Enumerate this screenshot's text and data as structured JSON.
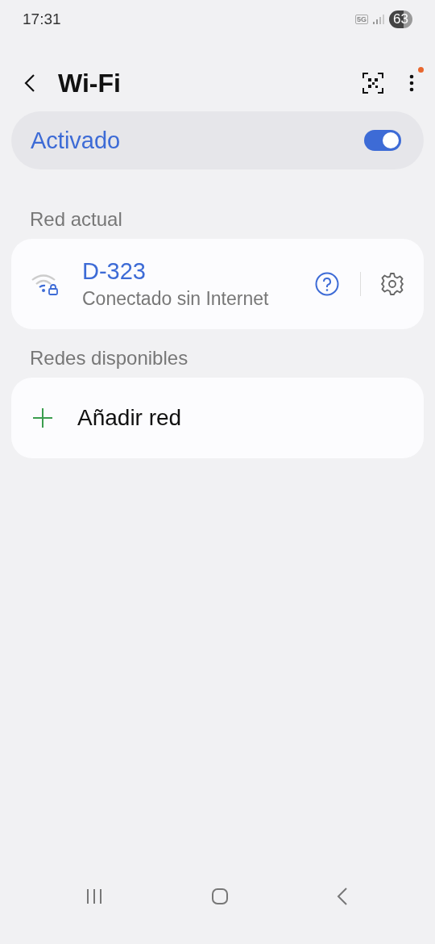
{
  "status_bar": {
    "time": "17:31",
    "network": "5G",
    "battery": "63"
  },
  "header": {
    "title": "Wi-Fi",
    "notification_dot": true
  },
  "master_switch": {
    "label": "Activado",
    "on": true
  },
  "current_section": {
    "title": "Red actual"
  },
  "current_network": {
    "name": "D-323",
    "status": "Conectado sin Internet",
    "secured": true
  },
  "available_section": {
    "title": "Redes disponibles"
  },
  "add_network": {
    "label": "Añadir red"
  }
}
